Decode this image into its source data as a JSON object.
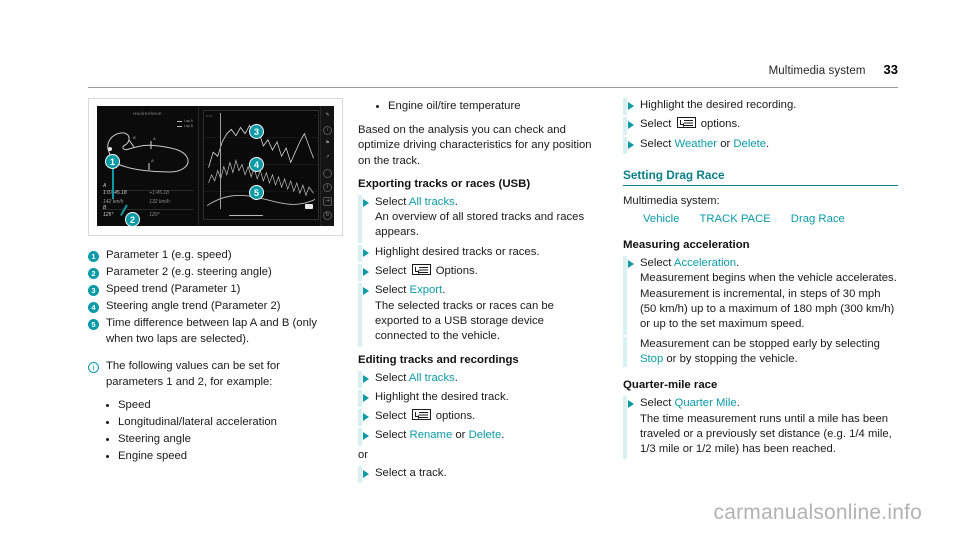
{
  "header": {
    "title": "Multimedia system",
    "page_number": "33"
  },
  "figure": {
    "screen_title": "Hockenheim",
    "legend_a": "Lap A",
    "legend_b": "Lap B",
    "lap_time": "1:07.45.18",
    "lap_delta": "+1:45.18",
    "speed_a": "142 km/h",
    "speed_b": "132 km/h",
    "angle_a": "125°",
    "angle_b": "120°",
    "mark_a": "A",
    "mark_b": "B",
    "callouts": [
      "1",
      "2",
      "3",
      "4",
      "5"
    ]
  },
  "legend_items": [
    {
      "num": "1",
      "text": "Parameter 1 (e.g. speed)"
    },
    {
      "num": "2",
      "text": "Parameter 2 (e.g. steering angle)"
    },
    {
      "num": "3",
      "text": "Speed trend (Parameter 1)"
    },
    {
      "num": "4",
      "text": "Steering angle trend (Parameter 2)"
    },
    {
      "num": "5",
      "text": "Time difference between lap A and B (only when two laps are selected)."
    }
  ],
  "note": {
    "icon": "info-icon",
    "text": "The following values can be set for parameters 1 and 2, for example:",
    "bullets": [
      "Speed",
      "Longitudinal/lateral acceleration",
      "Steering angle",
      "Engine speed"
    ]
  },
  "column_middle": {
    "top_bullet": "Engine oil/tire temperature",
    "intro": "Based on the analysis you can check and optimize driving characteristics for any position on the track.",
    "exporting": {
      "heading": "Exporting tracks or races (USB)",
      "step1_select": "Select",
      "step1_link": "All tracks",
      "step1_end": ".",
      "step1_detail": "An overview of all stored tracks and races appears.",
      "step2": "Highlight desired tracks or races.",
      "step3_select": "Select",
      "step3_end": "Options.",
      "step4_select": "Select",
      "step4_link": "Export",
      "step4_end": ".",
      "step4_detail": "The selected tracks or races can be exported to a USB storage device connected to the vehicle."
    },
    "editing": {
      "heading": "Editing tracks and recordings",
      "step1_select": "Select",
      "step1_link": "All tracks",
      "step1_end": ".",
      "step2": "Highlight the desired track.",
      "step3_select": "Select",
      "step3_end": "options.",
      "step4_select": "Select",
      "step4_link1": "Rename",
      "step4_or": "or",
      "step4_link2": "Delete",
      "step4_end": ".",
      "or_label": "or",
      "step5": "Select a track."
    }
  },
  "column_right": {
    "step_highlight": "Highlight the desired recording.",
    "step_options_select": "Select",
    "step_options_end": "options.",
    "step_weather_select": "Select",
    "step_weather_link1": "Weather",
    "step_weather_or": "or",
    "step_weather_link2": "Delete",
    "step_weather_end": ".",
    "section_heading": "Setting Drag Race",
    "multimedia_label": "Multimedia system:",
    "menu_path": [
      "Vehicle",
      "TRACK PACE",
      "Drag Race"
    ],
    "measuring": {
      "heading": "Measuring acceleration",
      "select": "Select",
      "link": "Acceleration",
      "end": ".",
      "detail": "Measurement begins when the vehicle accelerates. Measurement is incremental, in steps of 30 mph (50 km/h) up to a maximum of 180 mph (300 km/h) or up to the set maximum speed.",
      "detail2_pre": "Measurement can be stopped early by selecting",
      "detail2_link": "Stop",
      "detail2_post": "or by stopping the vehicle."
    },
    "quarter": {
      "heading": "Quarter-mile race",
      "select": "Select",
      "link": "Quarter Mile",
      "end": ".",
      "detail": "The time measurement runs until a mile has been traveled or a previously set distance (e.g. 1/4 mile, 1/3 mile or 1/2 mile) has been reached."
    }
  },
  "watermark": "carmanualsonline.info",
  "colors": {
    "accent": "#0b9aa6",
    "accent_dark": "#0b7f88",
    "stripe": "#d9f0f1"
  }
}
